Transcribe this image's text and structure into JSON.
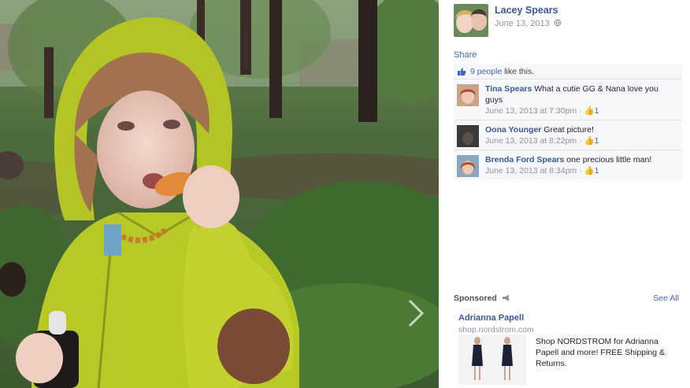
{
  "poster": {
    "name": "Lacey Spears",
    "date": "June 13, 2013"
  },
  "share_label": "Share",
  "likes": {
    "count_label": "9 people",
    "suffix": " like this."
  },
  "comments": [
    {
      "author": "Tina Spears",
      "text": " What a cutie GG & Nana love you guys",
      "time": "June 13, 2013 at 7:30pm · ",
      "likes": "1"
    },
    {
      "author": "Oona Younger",
      "text": " Great picture!",
      "time": "June 13, 2013 at 8:22pm · ",
      "likes": "1"
    },
    {
      "author": "Brenda Ford Spears",
      "text": " one precious little man!",
      "time": "June 13, 2013 at 8:34pm · ",
      "likes": "1"
    }
  ],
  "sponsored": {
    "label": "Sponsored",
    "see_all": "See All",
    "ad": {
      "title": "Adrianna Papell",
      "url": "shop.nordstrom.com",
      "text": "Shop NORDSTROM for Adrianna Papell and more! FREE Shipping & Returns."
    }
  },
  "colors": {
    "link": "#3b5998",
    "jacket": "#b8c826",
    "ufi_bg": "#f6f7f9"
  },
  "icons": [
    "globe-icon",
    "like-thumb-icon",
    "megaphone-icon",
    "next-arrow-icon"
  ]
}
